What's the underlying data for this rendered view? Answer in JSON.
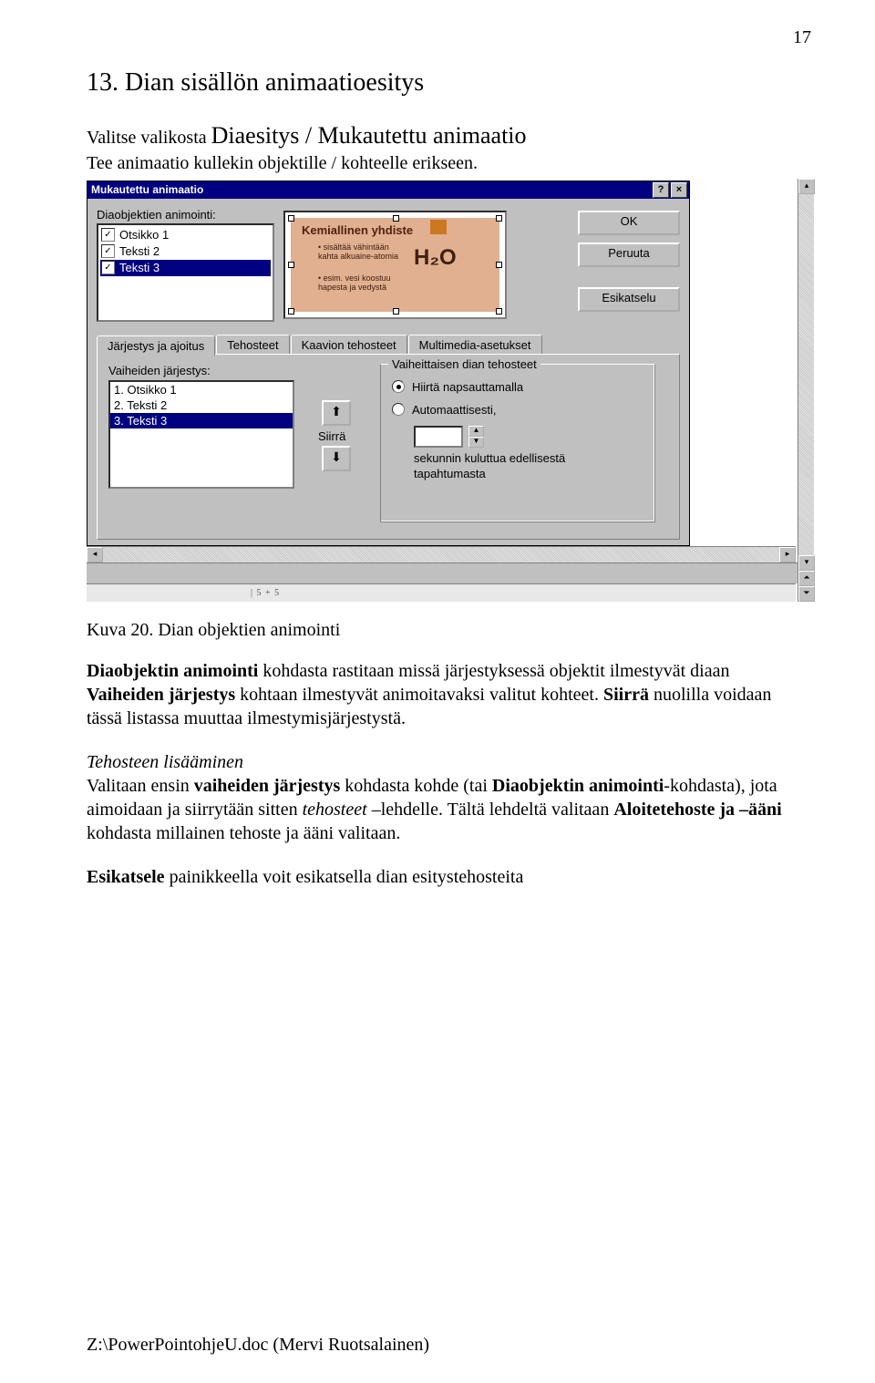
{
  "page_number": "17",
  "heading": "13. Dian sisällön animaatioesitys",
  "intro": {
    "line1_pre": "Valitse valikosta ",
    "line1_big": "Diaesitys / Mukautettu animaatio",
    "line2": "Tee animaatio kullekin objektille / kohteelle erikseen."
  },
  "caption": "Kuva 20. Dian objektien animointi",
  "para2": {
    "l1a": "Diaobjektin animointi",
    "l1b": " kohdasta rastitaan missä järjestyksessä objektit ilmestyvät diaan",
    "l2a": "Vaiheiden järjestys",
    "l2b": " kohtaan ilmestyvät animoitavaksi valitut kohteet. ",
    "l2c": "Siirrä",
    "l2d": " nuolilla voidaan tässä listassa muuttaa ilmestymisjärjestystä."
  },
  "para3": {
    "h": "Tehosteen lisääminen",
    "l1a": "Valitaan ensin ",
    "l1b": "vaiheiden järjestys",
    "l1c": " kohdasta kohde (tai ",
    "l1d": "Diaobjektin animointi",
    "l1e": "-kohdasta), jota aimoidaan ja siirrytään sitten ",
    "l1f": "tehosteet",
    "l1g": " –lehdelle. Tältä lehdeltä valitaan ",
    "l1h": "Aloitetehoste ja –ääni",
    "l1i": " kohdasta millainen tehoste ja ääni valitaan."
  },
  "para4": {
    "a": "Esikatsele",
    "b": " painikkeella voit esikatsella dian esitystehosteita"
  },
  "footer": "Z:\\PowerPointohjeU.doc (Mervi Ruotsalainen)",
  "dialog": {
    "title": "Mukautettu animaatio",
    "help_btn": "?",
    "close_btn": "×",
    "anim_label": "Diaobjektien animointi:",
    "items": [
      {
        "label": "Otsikko 1",
        "checked": true,
        "sel": false
      },
      {
        "label": "Teksti 2",
        "checked": true,
        "sel": false
      },
      {
        "label": "Teksti 3",
        "checked": true,
        "sel": true
      }
    ],
    "buttons": {
      "ok": "OK",
      "cancel": "Peruuta",
      "preview": "Esikatselu"
    },
    "preview": {
      "title": "Kemiallinen yhdiste",
      "sub1": "• sisältää vähintään kahta alkuaine-atomia",
      "big": "H₂O",
      "sub2": "• esim. vesi koostuu hapesta ja vedystä"
    },
    "tabs": [
      "Järjestys ja ajoitus",
      "Tehosteet",
      "Kaavion tehosteet",
      "Multimedia-asetukset"
    ],
    "order_label": "Vaiheiden järjestys:",
    "order_items": [
      {
        "label": "1. Otsikko 1",
        "sel": false
      },
      {
        "label": "2. Teksti 2",
        "sel": false
      },
      {
        "label": "3. Teksti 3",
        "sel": true
      }
    ],
    "siirra": "Siirrä",
    "group_title": "Vaiheittaisen dian tehosteet",
    "radio1": "Hiirtä napsauttamalla",
    "radio2": "Automaattisesti,",
    "sec_after": "sekunnin kuluttua edellisestä",
    "sec_after2": "tapahtumasta",
    "arrow_up": "⬆",
    "arrow_down": "⬇"
  },
  "ruler_text": "| 5 + 5"
}
